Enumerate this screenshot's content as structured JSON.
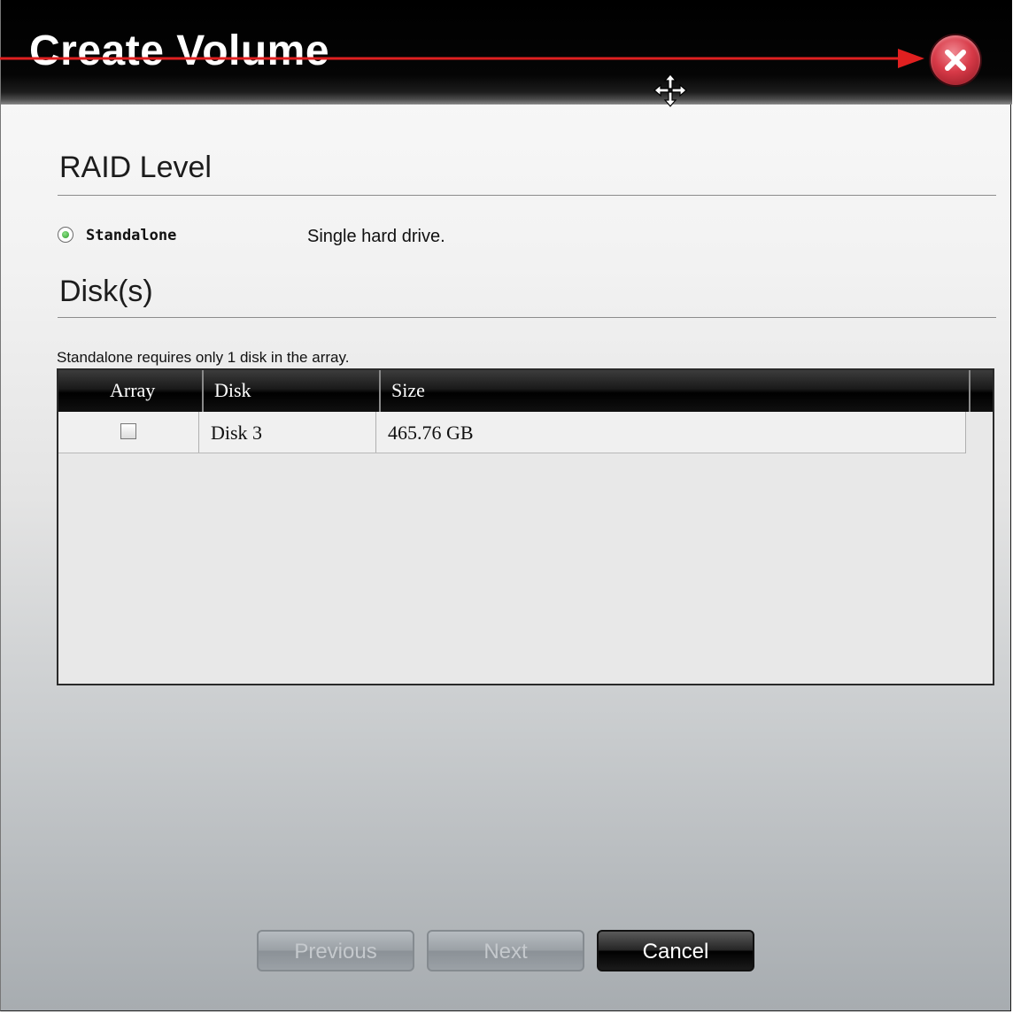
{
  "dialog": {
    "title": "Create Volume",
    "close_icon": "close-x-icon",
    "move_icon": "move-cursor-icon"
  },
  "raid": {
    "heading": "RAID Level",
    "options": [
      {
        "label": "Standalone",
        "description": "Single hard drive.",
        "selected": true
      }
    ]
  },
  "disks": {
    "heading": "Disk(s)",
    "hint": "Standalone requires only 1 disk in the array.",
    "columns": [
      "Array",
      "Disk",
      "Size"
    ],
    "rows": [
      {
        "array_checked": false,
        "disk": "Disk 3",
        "size": "465.76 GB"
      }
    ]
  },
  "buttons": {
    "previous": "Previous",
    "next": "Next",
    "cancel": "Cancel"
  },
  "colors": {
    "annotation_arrow": "#e02020",
    "close_button": "#d83a48",
    "radio_selected": "#2e9a2a"
  }
}
